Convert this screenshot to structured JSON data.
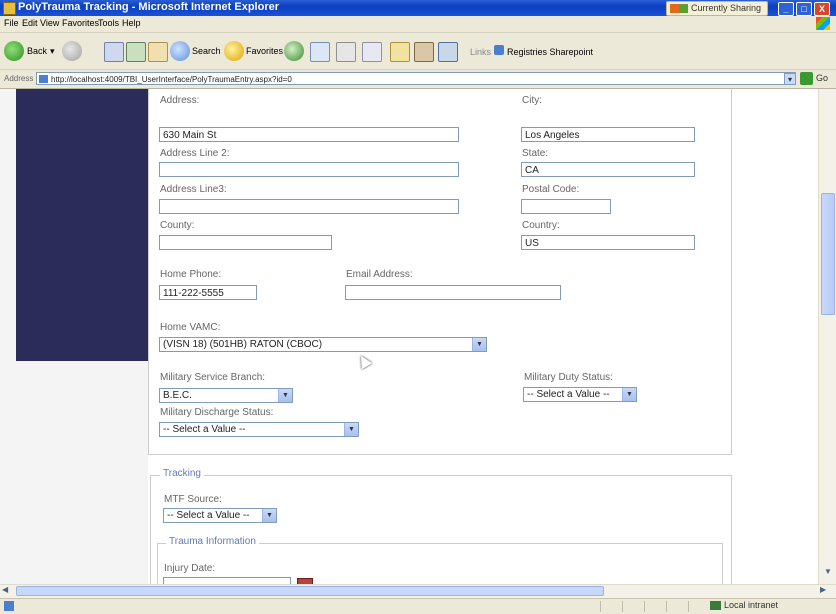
{
  "window": {
    "title": "PolyTrauma Tracking - Microsoft Internet Explorer",
    "sharing_label": "Currently Sharing",
    "min": "_",
    "max": "□",
    "close": "X"
  },
  "menu": [
    "File",
    "Edit",
    "View",
    "Favorites",
    "Tools",
    "Help"
  ],
  "toolbar": {
    "back": "Back",
    "search": "Search",
    "favorites": "Favorites",
    "links_label": "Links",
    "registries": "Registries Sharepoint"
  },
  "address": {
    "label": "Address",
    "url": "http://localhost:4009/TBI_UserInterface/PolyTraumaEntry.aspx?id=0",
    "go": "Go"
  },
  "form": {
    "address_label": "Address:",
    "address_value": "630 Main St",
    "city_label": "City:",
    "city_value": "Los Angeles",
    "address2_label": "Address Line 2:",
    "address2_value": "",
    "state_label": "State:",
    "state_value": "CA",
    "address3_label": "Address Line3:",
    "address3_value": "",
    "postal_label": "Postal Code:",
    "postal_value": "",
    "county_label": "County:",
    "county_value": "",
    "country_label": "Country:",
    "country_value": "US",
    "home_phone_label": "Home Phone:",
    "home_phone_value": "111-222-5555",
    "email_label": "Email Address:",
    "email_value": "",
    "vamc_label": "Home VAMC:",
    "vamc_value": "(VISN 18) (501HB) RATON (CBOC)",
    "branch_label": "Military Service Branch:",
    "branch_value": "B.E.C.",
    "duty_label": "Military Duty Status:",
    "duty_value": "-- Select a Value --",
    "discharge_label": "Military Discharge Status:",
    "discharge_value": "-- Select a Value --"
  },
  "tracking": {
    "legend": "Tracking",
    "mtf_label": "MTF Source:",
    "mtf_value": "-- Select a Value --",
    "trauma_legend": "Trauma Information",
    "injury_label": "Injury Date:",
    "injury_value": ""
  },
  "status": {
    "zone": "Local intranet"
  }
}
